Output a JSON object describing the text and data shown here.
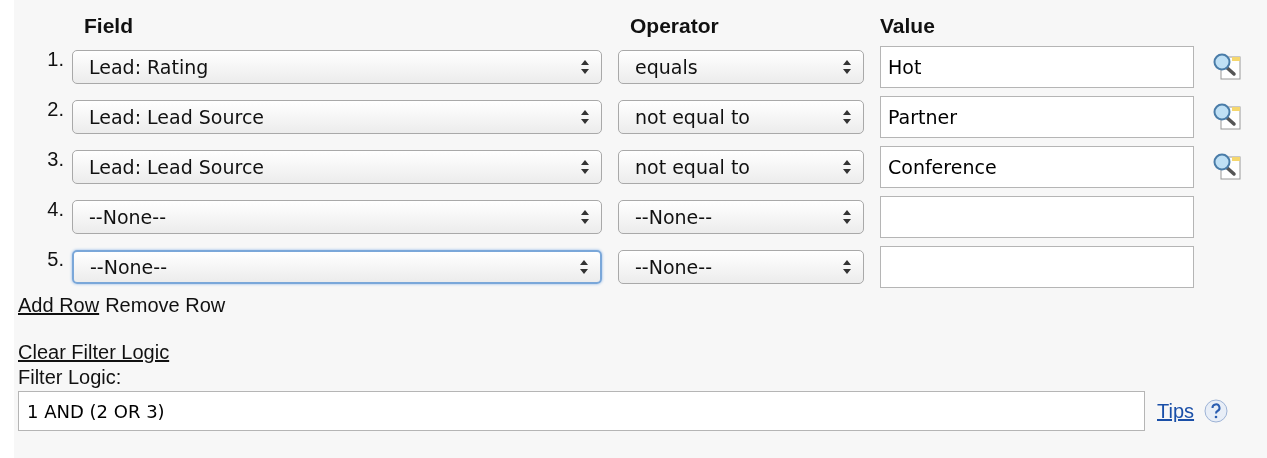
{
  "columns": [
    "Field",
    "Operator",
    "Value"
  ],
  "rows": [
    {
      "number": "1.",
      "field": "Lead: Rating",
      "field_focused": false,
      "operator": "equals",
      "value": "Hot",
      "lookup": true
    },
    {
      "number": "2.",
      "field": "Lead: Lead Source",
      "field_focused": false,
      "operator": "not equal to",
      "value": "Partner",
      "lookup": true
    },
    {
      "number": "3.",
      "field": "Lead: Lead Source",
      "field_focused": false,
      "operator": "not equal to",
      "value": "Conference",
      "lookup": true
    },
    {
      "number": "4.",
      "field": "--None--",
      "field_focused": false,
      "operator": "--None--",
      "value": "",
      "lookup": false
    },
    {
      "number": "5.",
      "field": "--None--",
      "field_focused": true,
      "operator": "--None--",
      "value": "",
      "lookup": false
    }
  ],
  "add_row": {
    "label": "Add Row"
  },
  "remove_row": {
    "label": "Remove Row",
    "disabled": true
  },
  "clear_filter_logic": "Clear Filter Logic",
  "filter_logic": {
    "label": "Filter Logic:",
    "value": "1 AND (2 OR 3)"
  },
  "tips": "Tips"
}
